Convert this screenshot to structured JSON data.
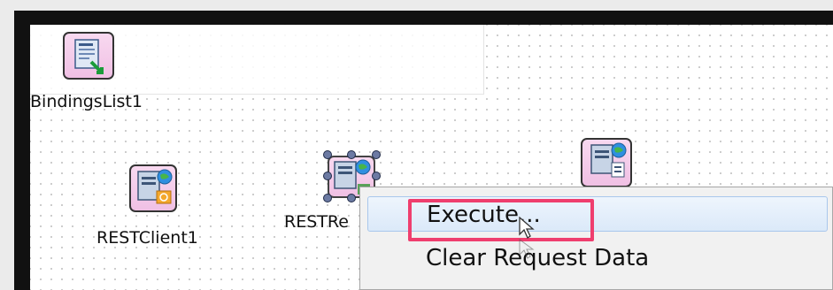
{
  "components": {
    "bindings_list": {
      "label": "BindingsList1",
      "icon": "bindings-list-icon"
    },
    "rest_client": {
      "label": "RESTClient1",
      "icon": "rest-client-icon"
    },
    "rest_request": {
      "label": "RESTRe",
      "icon": "rest-request-icon"
    },
    "rest_response": {
      "label": "",
      "icon": "rest-response-icon"
    }
  },
  "context_menu": {
    "items": [
      {
        "label": "Execute...",
        "state": "hover"
      },
      {
        "label": "Clear Request Data",
        "state": "normal"
      }
    ]
  },
  "colors": {
    "highlight": "#ef3e6e",
    "selection_handle": "#6c7aa3",
    "icon_background": "#f4cce9",
    "menu_hover": "#dbe9f9"
  }
}
